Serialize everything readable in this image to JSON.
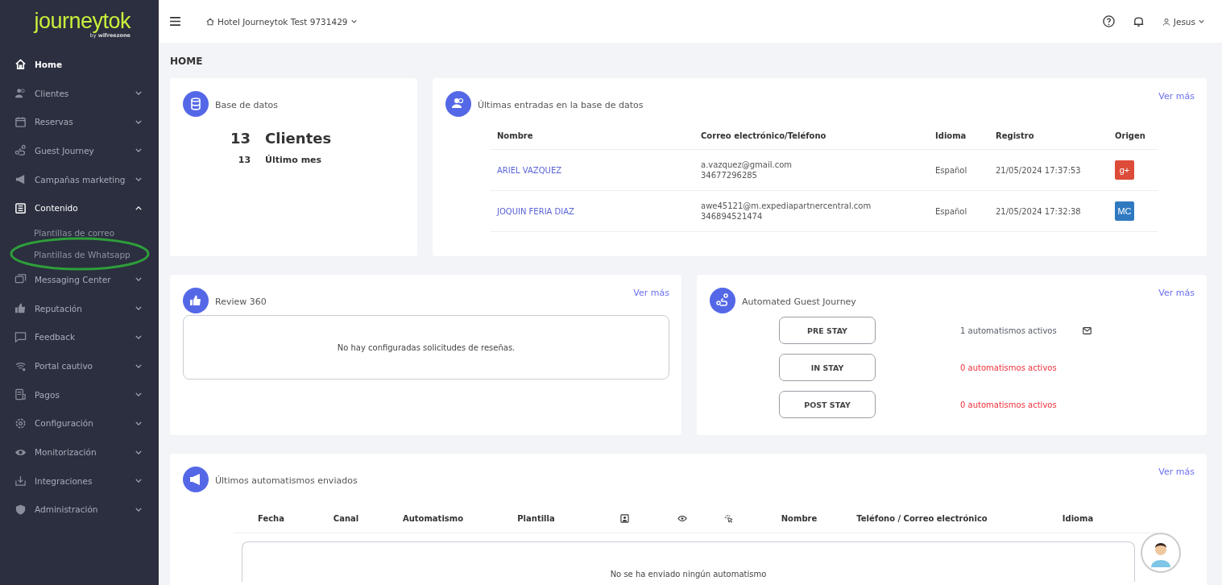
{
  "brand": {
    "name": "journeytok",
    "byline_prefix": "by",
    "byline": "wifreezone"
  },
  "sidebar": {
    "items": [
      {
        "label": "Home",
        "kind": "link",
        "selected": true
      },
      {
        "label": "Clientes",
        "kind": "group",
        "selected": false,
        "expanded": false
      },
      {
        "label": "Reservas",
        "kind": "group",
        "selected": false,
        "expanded": false
      },
      {
        "label": "Guest Journey",
        "kind": "group",
        "selected": false,
        "expanded": false
      },
      {
        "label": "Campañas marketing",
        "kind": "group",
        "selected": false,
        "expanded": false
      },
      {
        "label": "Contenido",
        "kind": "group",
        "selected": false,
        "expanded": true,
        "children": [
          {
            "label": "Plantillas de correo"
          },
          {
            "label": "Plantillas de Whatsapp"
          }
        ]
      },
      {
        "label": "Messaging Center",
        "kind": "group",
        "selected": false,
        "expanded": false
      },
      {
        "label": "Reputación",
        "kind": "group",
        "selected": false,
        "expanded": false
      },
      {
        "label": "Feedback",
        "kind": "group",
        "selected": false,
        "expanded": false
      },
      {
        "label": "Portal cautivo",
        "kind": "group",
        "selected": false,
        "expanded": false
      },
      {
        "label": "Pagos",
        "kind": "group",
        "selected": false,
        "expanded": false
      },
      {
        "label": "Configuración",
        "kind": "group",
        "selected": false,
        "expanded": false
      },
      {
        "label": "Monitorización",
        "kind": "group",
        "selected": false,
        "expanded": false
      },
      {
        "label": "Integraciones",
        "kind": "group",
        "selected": false,
        "expanded": false
      },
      {
        "label": "Administración",
        "kind": "group",
        "selected": false,
        "expanded": false
      }
    ]
  },
  "topbar": {
    "hotel": "Hotel Journeytok Test 9731429",
    "user": "Jesus"
  },
  "page_title": "HOME",
  "database": {
    "title": "Base de datos",
    "total": "13",
    "total_label": "Clientes",
    "month": "13",
    "month_label": "Último mes"
  },
  "latest_entries": {
    "title": "Últimas entradas en la base de datos",
    "more": "Ver más",
    "columns": [
      "Nombre",
      "Correo electrónico/Teléfono",
      "Idioma",
      "Registro",
      "Origen"
    ],
    "rows": [
      {
        "name": "ARIEL VAZQUEZ",
        "email": "a.vazquez@gmail.com",
        "phone": "34677296285",
        "language": "Español",
        "registered": "21/05/2024 17:37:53",
        "origin": "g+",
        "color": "#dd4b39"
      },
      {
        "name": "JOQUIN FERIA DIAZ",
        "email": "awe45121@m.expediapartnercentral.com",
        "phone": "346894521474",
        "language": "Español",
        "registered": "21/05/2024 17:32:38",
        "origin": "MC",
        "color": "#2f79c0"
      }
    ]
  },
  "review": {
    "title": "Review 360",
    "more": "Ver más",
    "empty": "No hay configuradas solicitudes de reseñas."
  },
  "journey": {
    "title": "Automated Guest Journey",
    "more": "Ver más",
    "stages": [
      {
        "label": "PRE STAY",
        "status": "1 automatismos activos",
        "color": "#555a66",
        "mail": true
      },
      {
        "label": "IN STAY",
        "status": "0 automatismos activos",
        "color": "#f0303a",
        "mail": false
      },
      {
        "label": "POST STAY",
        "status": "0 automatismos activos",
        "color": "#f0303a",
        "mail": false
      }
    ]
  },
  "sent": {
    "title": "Últimos automatismos enviados",
    "more": "Ver más",
    "columns": [
      {
        "kind": "text",
        "label": "Fecha"
      },
      {
        "kind": "text",
        "label": "Canal"
      },
      {
        "kind": "text",
        "label": "Automatismo"
      },
      {
        "kind": "text",
        "label": "Plantilla"
      },
      {
        "kind": "icon"
      },
      {
        "kind": "icon"
      },
      {
        "kind": "icon"
      },
      {
        "kind": "text",
        "label": "Nombre"
      },
      {
        "kind": "text",
        "label": "Teléfono / Correo electrónico"
      },
      {
        "kind": "text",
        "label": "Idioma"
      }
    ],
    "empty": "No se ha enviado ningún automatismo"
  }
}
